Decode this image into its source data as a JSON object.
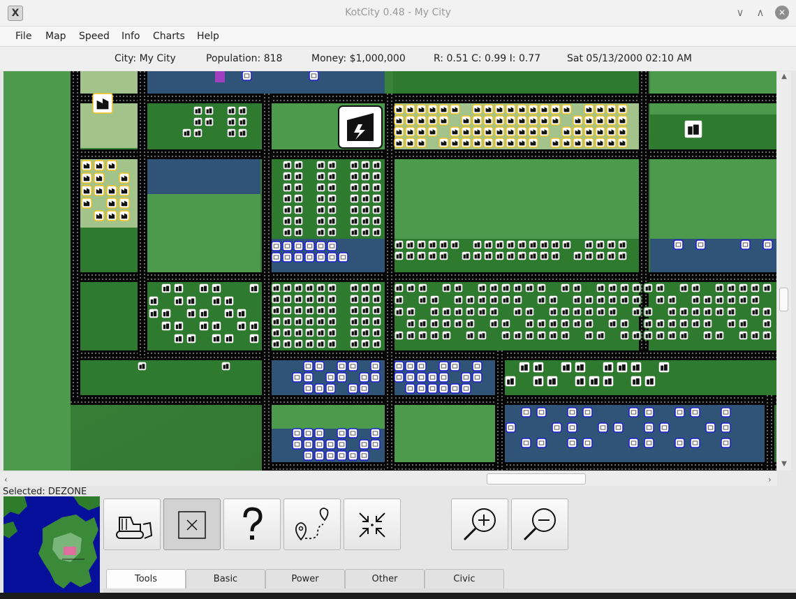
{
  "window": {
    "title": "KotCity 0.48 - My City",
    "app_icon": "X",
    "minimize_glyph": "∨",
    "maximize_glyph": "∧",
    "close_glyph": "✕"
  },
  "menu": [
    {
      "label": "File"
    },
    {
      "label": "Map"
    },
    {
      "label": "Speed"
    },
    {
      "label": "Info"
    },
    {
      "label": "Charts"
    },
    {
      "label": "Help"
    }
  ],
  "status": {
    "city": "City: My City",
    "population": "Population: 818",
    "money": "Money: $1,000,000",
    "demand": "R: 0.51 C: 0.99 I: 0.77",
    "datetime": "Sat 05/13/2000 02:10 AM"
  },
  "selected": "Selected: DEZONE",
  "tools": [
    {
      "name": "bulldozer-icon",
      "active": false
    },
    {
      "name": "dezone-icon",
      "active": true
    },
    {
      "name": "query-icon",
      "active": false
    },
    {
      "name": "route-icon",
      "active": false
    },
    {
      "name": "recenter-icon",
      "active": false
    },
    {
      "name": "zoom-in-icon",
      "active": false
    },
    {
      "name": "zoom-out-icon",
      "active": false
    }
  ],
  "tabs": [
    {
      "label": "Tools",
      "active": true
    },
    {
      "label": "Basic",
      "active": false
    },
    {
      "label": "Power",
      "active": false
    },
    {
      "label": "Other",
      "active": false
    },
    {
      "label": "Civic",
      "active": false
    }
  ],
  "colors": {
    "road": "#050505",
    "residential": "#2e7a2e",
    "commercial": "#2f5478",
    "industrial": "#a2c48a",
    "grass": "#4c9a4c",
    "zone_border_residential": "#2f7a2f",
    "zone_border_commercial": "#1f1fd0",
    "zone_border_industrial": "#f0c020"
  }
}
